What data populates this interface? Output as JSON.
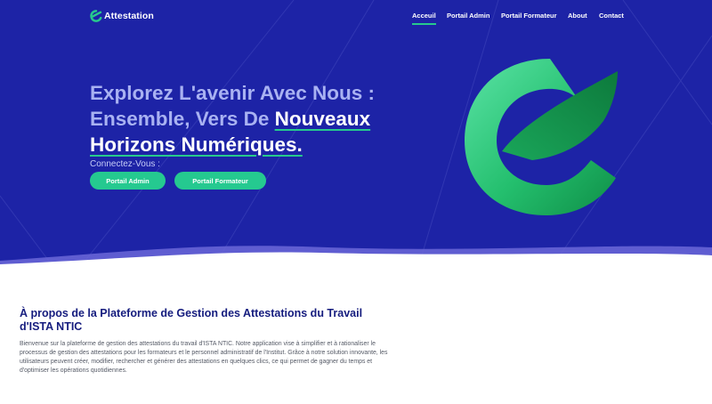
{
  "brand": {
    "logo_text": "Attestation"
  },
  "nav": {
    "items": [
      {
        "label": "Acceuil",
        "active": true
      },
      {
        "label": "Portail Admin"
      },
      {
        "label": "Portail Formateur"
      },
      {
        "label": "About"
      },
      {
        "label": "Contact"
      }
    ]
  },
  "hero": {
    "title_part1": "Explorez L'avenir Avec Nous : Ensemble, Vers De ",
    "title_highlight1": "Nouveaux",
    "title_highlight2": "Horizons Numériques.",
    "connect_label": "Connectez-Vous :",
    "admin_button": "Portail Admin",
    "formateur_button": "Portail Formateur"
  },
  "about": {
    "title": "À propos de la Plateforme de Gestion des Attestations du Travail d'ISTA NTIC",
    "text": "Bienvenue sur la plateforme de gestion des attestations du travail d'ISTA NTIC. Notre application vise à simplifier et à rationaliser le processus de gestion des attestations pour les formateurs et le personnel administratif de l'Institut. Grâce à notre solution innovante, les utilisateurs peuvent créer, modifier, rechercher et générer des attestations en quelques clics, ce qui permet de gagner du temps et d'optimiser les opérations quotidiennes."
  },
  "colors": {
    "hero_bg": "#1d23a6",
    "accent_green": "#25c990",
    "title_muted": "#a9b2f2",
    "about_title": "#151c7e"
  },
  "icons": {
    "brand": "e-logo-icon",
    "hero": "large-e-logo-icon"
  }
}
